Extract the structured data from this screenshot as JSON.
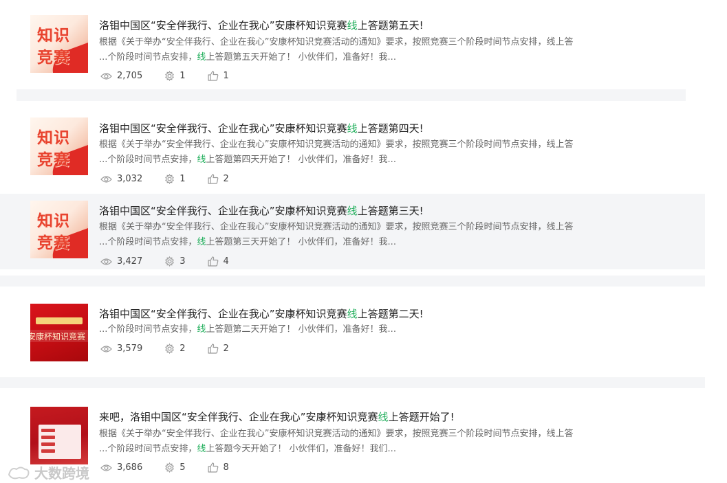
{
  "items": [
    {
      "title_pre": "洛钼中国区“安全伴我行、企业在我心”安康杯知识竞赛",
      "title_hl": "线",
      "title_post": "上答题第五天!",
      "desc_line1": "根据《关于举办“安全伴我行、企业在我心”安康杯知识竞赛活动的通知》要求，按照竞赛三个阶段时间节点安排，线上答",
      "desc_pre": "...个阶段时间节点安排，",
      "desc_hl": "线",
      "desc_post": "上答题第五天开始了！ 小伙伴们，准备好！我...",
      "views": "2,705",
      "shares": "1",
      "likes": "1",
      "thumb_text1": "知识",
      "thumb_text2": "竞赛"
    },
    {
      "title_pre": "洛钼中国区“安全伴我行、企业在我心”安康杯知识竞赛",
      "title_hl": "线",
      "title_post": "上答题第四天!",
      "desc_line1": "根据《关于举办“安全伴我行、企业在我心”安康杯知识竞赛活动的通知》要求，按照竞赛三个阶段时间节点安排，线上答",
      "desc_pre": "...个阶段时间节点安排，",
      "desc_hl": "线",
      "desc_post": "上答题第四天开始了！ 小伙伴们，准备好！我...",
      "views": "3,032",
      "shares": "1",
      "likes": "2",
      "thumb_text1": "知识",
      "thumb_text2": "竞赛"
    },
    {
      "title_pre": "洛钼中国区“安全伴我行、企业在我心”安康杯知识竞赛",
      "title_hl": "线",
      "title_post": "上答题第三天!",
      "desc_line1": "根据《关于举办“安全伴我行、企业在我心”安康杯知识竞赛活动的通知》要求，按照竞赛三个阶段时间节点安排，线上答",
      "desc_pre": "...个阶段时间节点安排，",
      "desc_hl": "线",
      "desc_post": "上答题第三天开始了！ 小伙伴们，准备好！我...",
      "views": "3,427",
      "shares": "3",
      "likes": "4",
      "thumb_text1": "知识",
      "thumb_text2": "竞赛"
    },
    {
      "title_pre": "洛钼中国区“安全伴我行、企业在我心”安康杯知识竞赛",
      "title_hl": "线",
      "title_post": "上答题第二天!",
      "desc_pre": "...个阶段时间节点安排，",
      "desc_hl": "线",
      "desc_post": "上答题第二天开始了！ 小伙伴们，准备好！我...",
      "views": "3,579",
      "shares": "2",
      "likes": "2",
      "thumb_text1": "安康杯知识竞赛"
    },
    {
      "title_pre": "来吧，洛钼中国区“安全伴我行、企业在我心”安康杯知识竞赛",
      "title_hl": "线",
      "title_post": "上答题开始了!",
      "desc_line1": "根据《关于举办“安全伴我行、企业在我心”安康杯知识竞赛活动的通知》要求，按照竞赛三个阶段时间节点安排，线上答",
      "desc_pre": "...个阶段时间节点安排，",
      "desc_hl": "线",
      "desc_post": "上答题今天开始了！ 小伙伴们，准备好！我们...",
      "views": "3,686",
      "shares": "5",
      "likes": "8"
    }
  ],
  "watermark": "大数跨境",
  "colors": {
    "highlight": "#1fae5a",
    "band": "#f4f5f7"
  }
}
